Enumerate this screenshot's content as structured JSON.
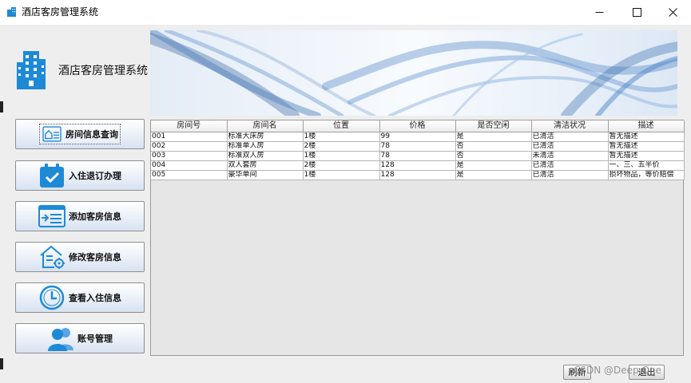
{
  "window": {
    "title": "酒店客房管理系统"
  },
  "brand": {
    "name": "酒店客房管理系统"
  },
  "menu": [
    {
      "label": "房间信息查询",
      "icon": "house-card-icon"
    },
    {
      "label": "入住退订办理",
      "icon": "calendar-check-icon"
    },
    {
      "label": "添加客房信息",
      "icon": "add-list-icon"
    },
    {
      "label": "修改客房信息",
      "icon": "house-settings-icon"
    },
    {
      "label": "查看入住信息",
      "icon": "clock-icon"
    },
    {
      "label": "账号管理",
      "icon": "users-icon"
    }
  ],
  "table": {
    "columns": [
      "房间号",
      "房间名",
      "位置",
      "价格",
      "是否空闲",
      "清洁状况",
      "描述"
    ],
    "rows": [
      [
        "001",
        "标准大床房",
        "1楼",
        "99",
        "是",
        "已清洁",
        "暂无描述"
      ],
      [
        "002",
        "标准单人房",
        "2楼",
        "78",
        "否",
        "已清洁",
        "暂无描述"
      ],
      [
        "003",
        "标准双人房",
        "1楼",
        "78",
        "否",
        "未清洁",
        "暂无描述"
      ],
      [
        "004",
        "双人套房",
        "2楼",
        "128",
        "是",
        "已清洁",
        "一、三、五半价"
      ],
      [
        "005",
        "豪华单间",
        "1楼",
        "128",
        "是",
        "已清洁",
        "损坏物品，等价赔偿"
      ]
    ]
  },
  "buttons": {
    "refresh": "刷新",
    "exit": "退出"
  },
  "watermark": "CSDN @Deep One",
  "colors": {
    "accent": "#1e8ad6"
  }
}
